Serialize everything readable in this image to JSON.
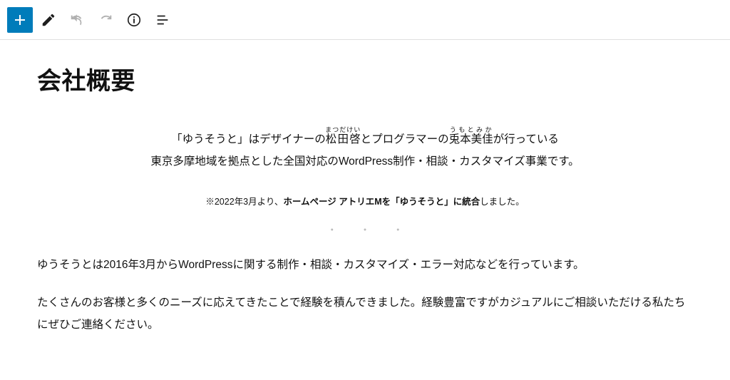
{
  "toolbar": {
    "add": "add-block",
    "edit": "edit",
    "undo": "undo",
    "redo": "redo",
    "info": "document-info",
    "outline": "outline"
  },
  "page": {
    "title": "会社概要",
    "intro_line1_pre": "「ゆうそうと」はデザイナーの",
    "intro_name1": "松田啓",
    "intro_name1_ruby": "まつだけい",
    "intro_line1_mid": "とプログラマーの",
    "intro_name2": "兎本美佳",
    "intro_name2_ruby": "うもとみか",
    "intro_line1_post": "が行っている",
    "intro_line2": "東京多摩地域を拠点とした全国対応のWordPress制作・相談・カスタマイズ事業です。",
    "note_pre": "※2022年3月より、",
    "note_bold": "ホームページ アトリエMを「ゆうそうと」に統合",
    "note_post": "しました。",
    "dots": "●●●",
    "para1": "ゆうそうとは2016年3月からWordPressに関する制作・相談・カスタマイズ・エラー対応などを行っています。",
    "para2": "たくさんのお客様と多くのニーズに応えてきたことで経験を積んできました。経験豊富ですがカジュアルにご相談いただける私たちにぜひご連絡ください。"
  }
}
